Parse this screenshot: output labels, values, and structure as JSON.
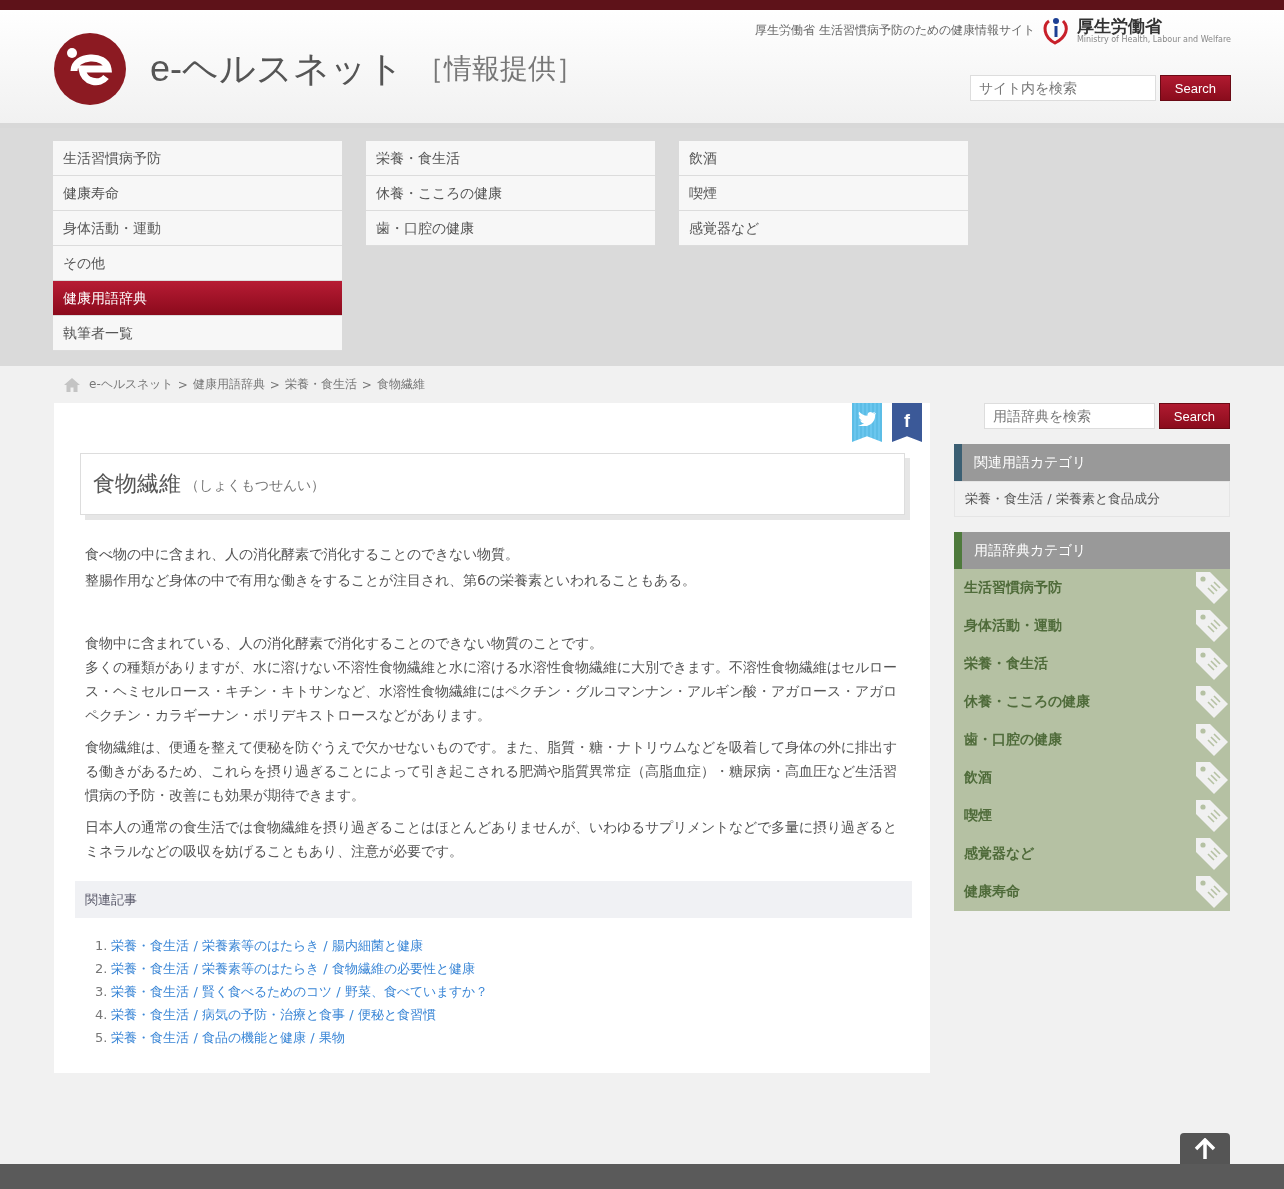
{
  "header": {
    "site_name": "e-ヘルスネット",
    "site_suffix": "［情報提供］",
    "tagline": "厚生労働省 生活習慣病予防のための健康情報サイト",
    "ministry": "厚生労働省",
    "ministry_en": "Ministry of Health, Labour and Welfare",
    "search": {
      "placeholder": "サイト内を検索",
      "button": "Search"
    }
  },
  "nav": [
    [
      {
        "label": "生活習慣病予防",
        "selected": false
      },
      {
        "label": "健康寿命",
        "selected": false
      },
      {
        "label": "身体活動・運動",
        "selected": false
      },
      {
        "label": "その他",
        "selected": false
      },
      {
        "label": "健康用語辞典",
        "selected": true
      },
      {
        "label": "執筆者一覧",
        "selected": false
      }
    ],
    [
      {
        "label": "栄養・食生活",
        "selected": false
      },
      {
        "label": "休養・こころの健康",
        "selected": false
      },
      {
        "label": "歯・口腔の健康",
        "selected": false
      }
    ],
    [
      {
        "label": "飲酒",
        "selected": false
      },
      {
        "label": "喫煙",
        "selected": false
      },
      {
        "label": "感覚器など",
        "selected": false
      }
    ]
  ],
  "breadcrumb": [
    "e-ヘルスネット",
    "健康用語辞典",
    "栄養・食生活",
    "食物繊維"
  ],
  "breadcrumb_separator": ">",
  "article": {
    "share_letter": "f",
    "title": "食物繊維",
    "reading": "（しょくもつせんい）",
    "summary": [
      "食べ物の中に含まれ、人の消化酵素で消化することのできない物質。",
      "整腸作用など身体の中で有用な働きをすることが注目され、第6の栄養素といわれることもある。"
    ],
    "body": [
      [
        "食物中に含まれている、人の消化酵素で消化することのできない物質のことです。",
        "多くの種類がありますが、水に溶けない不溶性食物繊維と水に溶ける水溶性食物繊維に大別できます。不溶性食物繊維はセルロース・ヘミセルロース・キチン・キトサンなど、水溶性食物繊維にはペクチン・グルコマンナン・アルギン酸・アガロース・アガロペクチン・カラギーナン・ポリデキストロースなどがあります。"
      ],
      [
        "食物繊維は、便通を整えて便秘を防ぐうえで欠かせないものです。また、脂質・糖・ナトリウムなどを吸着して身体の外に排出する働きがあるため、これらを摂り過ぎることによって引き起こされる肥満や脂質異常症（高脂血症）・糖尿病・高血圧など生活習慣病の予防・改善にも効果が期待できます。"
      ],
      [
        "日本人の通常の食生活では食物繊維を摂り過ぎることはほとんどありませんが、いわゆるサプリメントなどで多量に摂り過ぎるとミネラルなどの吸収を妨げることもあり、注意が必要です。"
      ]
    ],
    "related_title": "関連記事",
    "related": [
      {
        "num": "1.",
        "text": "栄養・食生活 / 栄養素等のはたらき / 腸内細菌と健康"
      },
      {
        "num": "2.",
        "text": "栄養・食生活 / 栄養素等のはたらき / 食物繊維の必要性と健康"
      },
      {
        "num": "3.",
        "text": "栄養・食生活 / 賢く食べるためのコツ / 野菜、食べていますか？"
      },
      {
        "num": "4.",
        "text": "栄養・食生活 / 病気の予防・治療と食事 / 便秘と食習慣"
      },
      {
        "num": "5.",
        "text": "栄養・食生活 / 食品の機能と健康 / 果物"
      }
    ]
  },
  "sidebar": {
    "search": {
      "placeholder": "用語辞典を検索",
      "button": "Search"
    },
    "panels": [
      {
        "kind": "related",
        "title": "関連用語カテゴリ",
        "color": "#3b5f73",
        "items": [
          "栄養・食生活 / 栄養素と食品成分"
        ]
      },
      {
        "kind": "tags",
        "title": "用語辞典カテゴリ",
        "color": "#4e7a3c",
        "items": [
          "生活習慣病予防",
          "身体活動・運動",
          "栄養・食生活",
          "休養・こころの健康",
          "歯・口腔の健康",
          "飲酒",
          "喫煙",
          "感覚器など",
          "健康寿命"
        ]
      }
    ]
  }
}
